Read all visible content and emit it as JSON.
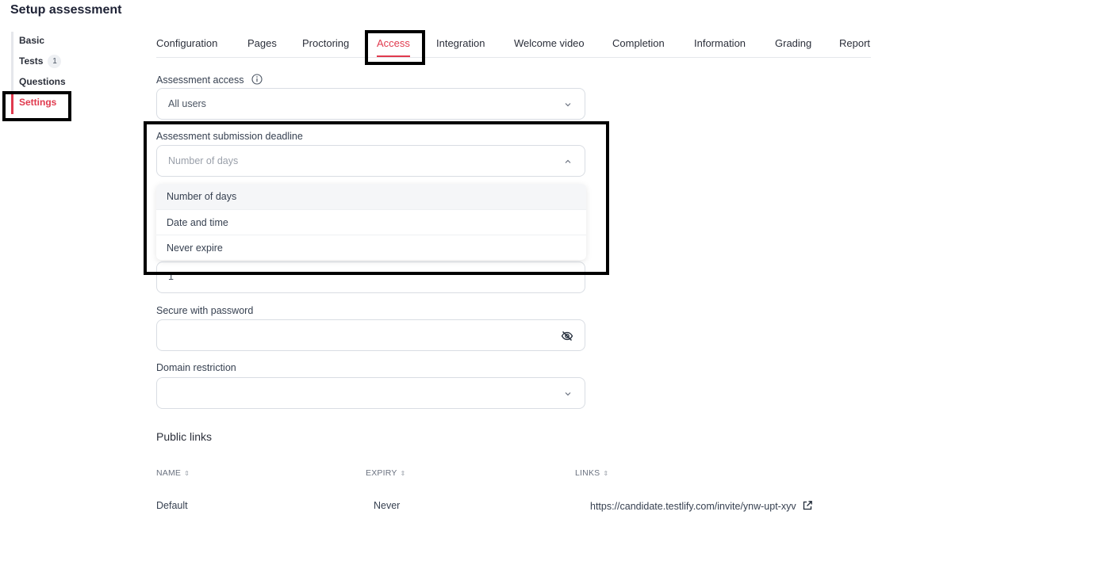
{
  "page": {
    "title": "Setup assessment"
  },
  "sidebar": {
    "items": [
      {
        "label": "Basic"
      },
      {
        "label": "Tests",
        "badge": "1"
      },
      {
        "label": "Questions"
      },
      {
        "label": "Settings",
        "active": true
      }
    ]
  },
  "tabs": [
    {
      "label": "Configuration"
    },
    {
      "label": "Pages"
    },
    {
      "label": "Proctoring"
    },
    {
      "label": "Access",
      "active": true
    },
    {
      "label": "Integration"
    },
    {
      "label": "Welcome video"
    },
    {
      "label": "Completion"
    },
    {
      "label": "Information"
    },
    {
      "label": "Grading"
    },
    {
      "label": "Report"
    }
  ],
  "access": {
    "label": "Assessment access",
    "value": "All users",
    "info_icon": "info-icon"
  },
  "deadline": {
    "label": "Assessment submission deadline",
    "placeholder": "Number of days",
    "options": [
      "Number of days",
      "Date and time",
      "Never expire"
    ],
    "hidden_field_value": "1"
  },
  "password": {
    "label": "Secure with password",
    "value": "",
    "toggle_icon": "eye-off-icon"
  },
  "domain": {
    "label": "Domain restriction",
    "value": ""
  },
  "public_links": {
    "title": "Public links",
    "columns": [
      "NAME",
      "EXPIRY",
      "LINKS"
    ],
    "rows": [
      {
        "name": "Default",
        "expiry": "Never",
        "link": "https://candidate.testlify.com/invite/ynw-upt-xyv"
      }
    ]
  },
  "colors": {
    "accent": "#e03a4e",
    "border": "#d9dde3",
    "text": "#1e2235"
  }
}
